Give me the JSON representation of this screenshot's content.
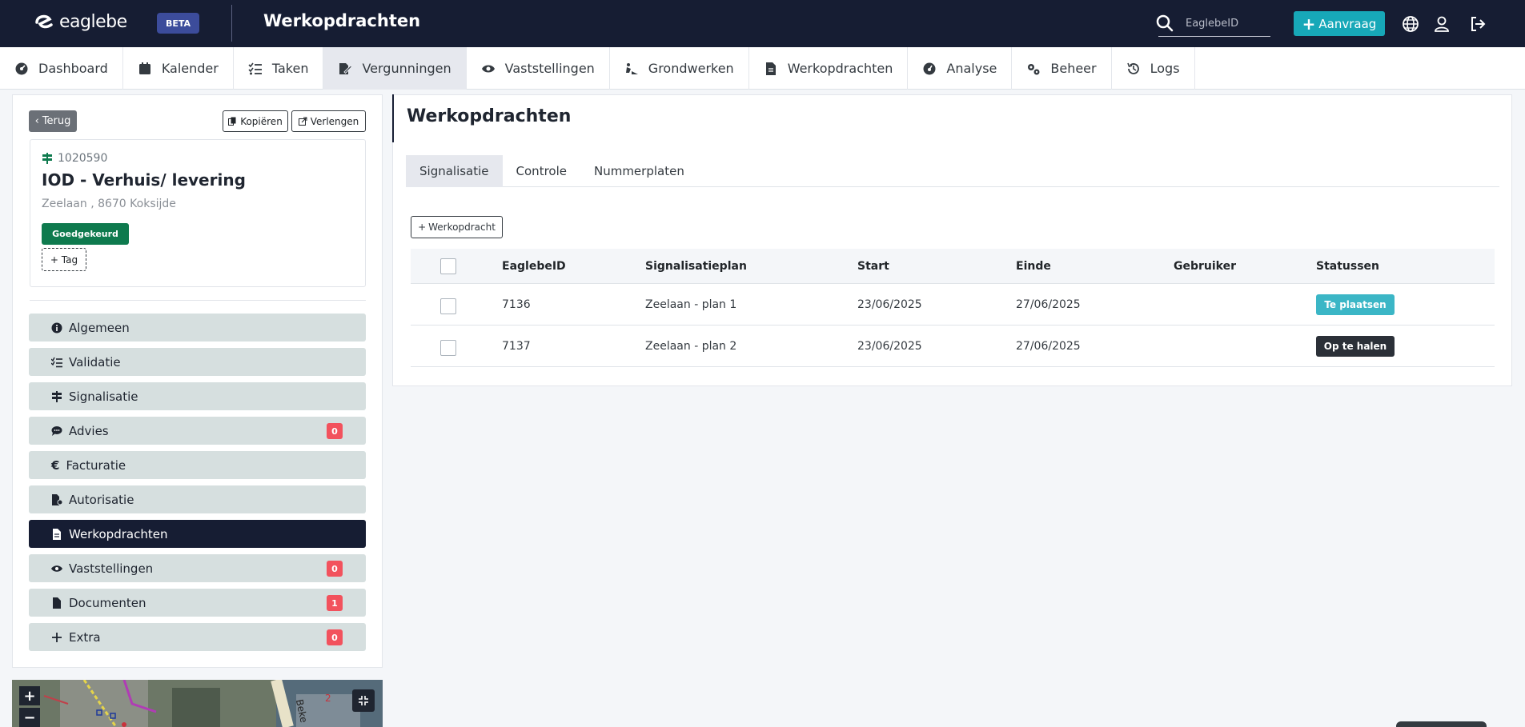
{
  "topbar": {
    "logo_text": "eaglebe",
    "beta": "BETA",
    "title": "Werkopdrachten",
    "search_placeholder": "EaglebeID",
    "aanvraag_label": "Aanvraag",
    "accent_color": "#17a8b8",
    "background": "#161d33"
  },
  "nav": {
    "items": [
      {
        "label": "Dashboard",
        "icon": "dashboard-icon"
      },
      {
        "label": "Kalender",
        "icon": "calendar-icon"
      },
      {
        "label": "Taken",
        "icon": "tasks-icon"
      },
      {
        "label": "Vergunningen",
        "icon": "permit-icon",
        "active": true
      },
      {
        "label": "Vaststellingen",
        "icon": "eye-icon"
      },
      {
        "label": "Grondwerken",
        "icon": "excavator-icon"
      },
      {
        "label": "Werkopdrachten",
        "icon": "document-icon"
      },
      {
        "label": "Analyse",
        "icon": "gauge-icon"
      },
      {
        "label": "Beheer",
        "icon": "gears-icon"
      },
      {
        "label": "Logs",
        "icon": "history-icon"
      }
    ]
  },
  "left": {
    "back_label": "Terug",
    "copy_label": "Kopiëren",
    "extend_label": "Verlengen",
    "permit": {
      "id": "1020590",
      "title": "IOD - Verhuis/ levering",
      "address": "Zeelaan , 8670 Koksijde",
      "status": "Goedgekeurd",
      "tag_label": "+ Tag"
    },
    "menu": [
      {
        "label": "Algemeen",
        "icon": "info-icon"
      },
      {
        "label": "Validatie",
        "icon": "checklist-icon"
      },
      {
        "label": "Signalisatie",
        "icon": "signpost-icon"
      },
      {
        "label": "Advies",
        "icon": "comments-icon",
        "count": "0"
      },
      {
        "label": "Facturatie",
        "icon": "euro-icon"
      },
      {
        "label": "Autorisatie",
        "icon": "file-signature-icon"
      },
      {
        "label": "Werkopdrachten",
        "icon": "document-icon",
        "active": true
      },
      {
        "label": "Vaststellingen",
        "icon": "eye-icon",
        "count": "0"
      },
      {
        "label": "Documenten",
        "icon": "file-icon",
        "count": "1"
      },
      {
        "label": "Extra",
        "icon": "plus-icon",
        "count": "0"
      }
    ],
    "map": {
      "zoom_in": "+",
      "zoom_out": "−",
      "street_label": "Beke",
      "marker": "2"
    }
  },
  "main": {
    "title": "Werkopdrachten",
    "tabs": [
      {
        "label": "Signalisatie",
        "active": true
      },
      {
        "label": "Controle"
      },
      {
        "label": "Nummerplaten"
      }
    ],
    "add_button": "Werkopdracht",
    "table": {
      "headers": [
        "EaglebeID",
        "Signalisatieplan",
        "Start",
        "Einde",
        "Gebruiker",
        "Statussen"
      ],
      "rows": [
        {
          "id": "7136",
          "plan": "Zeelaan - plan 1",
          "start": "23/06/2025",
          "end": "27/06/2025",
          "user": "",
          "status": "Te plaatsen",
          "status_color": "#3bb6c6"
        },
        {
          "id": "7137",
          "plan": "Zeelaan - plan 2",
          "start": "23/06/2025",
          "end": "27/06/2025",
          "user": "",
          "status": "Op te halen",
          "status_color": "#2b3038"
        }
      ]
    }
  }
}
